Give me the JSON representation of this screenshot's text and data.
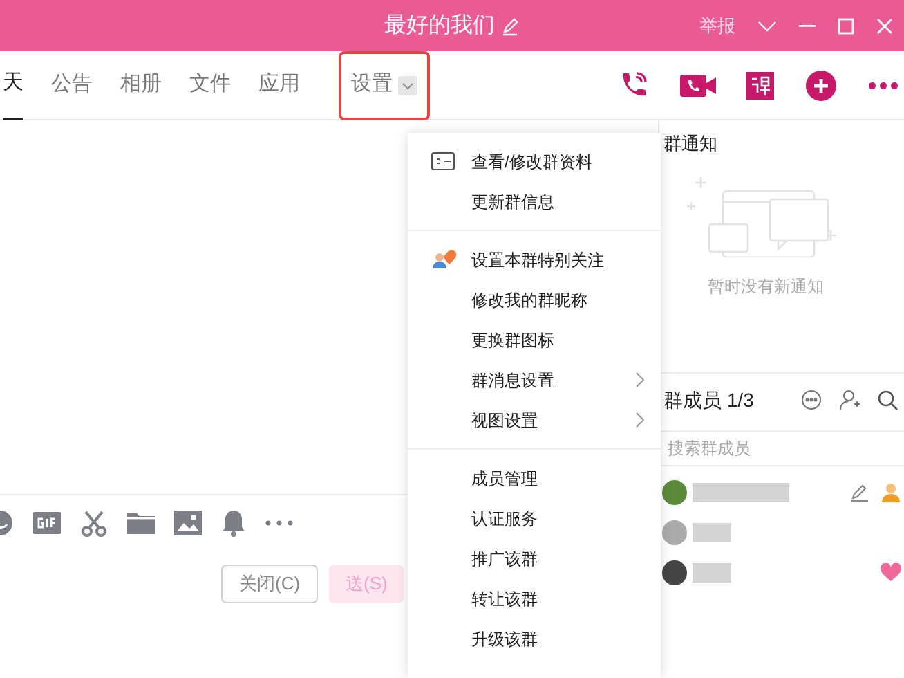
{
  "window": {
    "title": "最好的我们",
    "report": "举报"
  },
  "tabs": [
    {
      "label": "天",
      "selected": true,
      "dropdown": false,
      "highlighted": false
    },
    {
      "label": "公告",
      "selected": false,
      "dropdown": false,
      "highlighted": false
    },
    {
      "label": "相册",
      "selected": false,
      "dropdown": false,
      "highlighted": false
    },
    {
      "label": "文件",
      "selected": false,
      "dropdown": false,
      "highlighted": false
    },
    {
      "label": "应用",
      "selected": false,
      "dropdown": false,
      "highlighted": false
    },
    {
      "label": "设置",
      "selected": false,
      "dropdown": true,
      "highlighted": true
    }
  ],
  "menu": {
    "sections": [
      [
        {
          "label": "查看/修改群资料",
          "kind": "card",
          "submenu": false
        },
        {
          "label": "更新群信息",
          "kind": "plain",
          "submenu": false
        }
      ],
      [
        {
          "label": "设置本群特别关注",
          "kind": "heart-person",
          "submenu": false
        },
        {
          "label": "修改我的群昵称",
          "kind": "plain",
          "submenu": false
        },
        {
          "label": "更换群图标",
          "kind": "plain",
          "submenu": false
        },
        {
          "label": "群消息设置",
          "kind": "plain",
          "submenu": true
        },
        {
          "label": "视图设置",
          "kind": "plain",
          "submenu": true
        }
      ],
      [
        {
          "label": "成员管理",
          "kind": "plain",
          "submenu": false
        },
        {
          "label": "认证服务",
          "kind": "plain",
          "submenu": false
        },
        {
          "label": "推广该群",
          "kind": "plain",
          "submenu": false
        },
        {
          "label": "转让该群",
          "kind": "plain",
          "submenu": false
        },
        {
          "label": "升级该群",
          "kind": "plain",
          "submenu": false
        }
      ]
    ]
  },
  "notice": {
    "title": "群通知",
    "empty_text": "暂时没有新通知"
  },
  "members": {
    "title": "群成员 1/3",
    "search_placeholder": "搜索群成员",
    "items": [
      {
        "editable": true,
        "owner": true,
        "favorite": false
      },
      {
        "editable": false,
        "owner": false,
        "favorite": false
      },
      {
        "editable": false,
        "owner": false,
        "favorite": true
      }
    ]
  },
  "composer": {
    "close_label": "关闭(C)",
    "send_label": "送(S)"
  }
}
